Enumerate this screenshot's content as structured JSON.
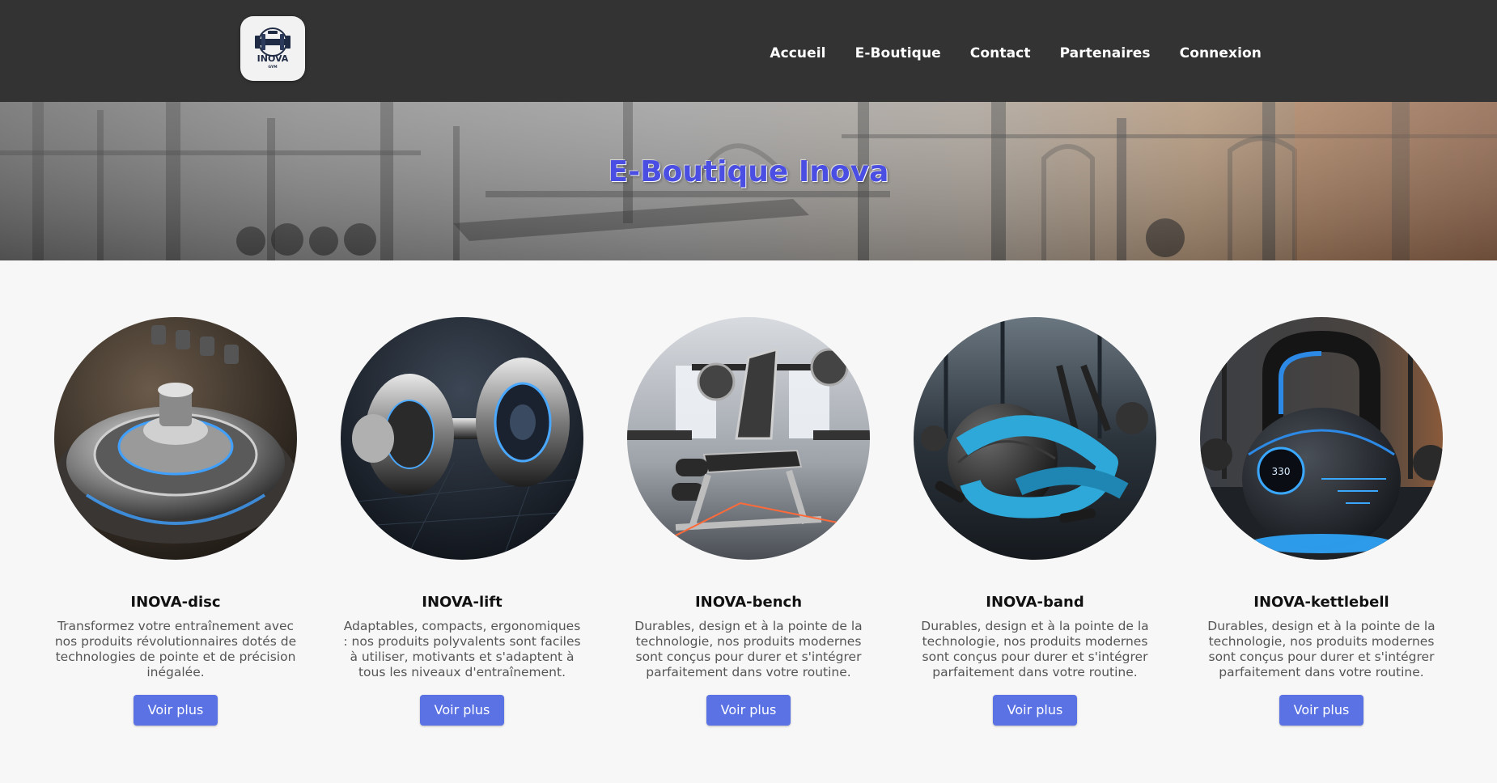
{
  "header": {
    "logo": {
      "text": "INOVA",
      "subtext": "GYM"
    },
    "nav": [
      {
        "label": "Accueil"
      },
      {
        "label": "E-Boutique"
      },
      {
        "label": "Contact"
      },
      {
        "label": "Partenaires"
      },
      {
        "label": "Connexion"
      }
    ]
  },
  "hero": {
    "title": "E-Boutique Inova"
  },
  "products": [
    {
      "name": "INOVA-disc",
      "description": "Transformez votre entraînement avec nos produits révolutionnaires dotés de technologies de pointe et de précision inégalée.",
      "button": "Voir plus",
      "image_icon": "disc-image"
    },
    {
      "name": "INOVA-lift",
      "description": "Adaptables, compacts, ergonomiques : nos produits polyvalents sont faciles à utiliser, motivants et s'adaptent à tous les niveaux d'entraînement.",
      "button": "Voir plus",
      "image_icon": "dumbbell-image"
    },
    {
      "name": "INOVA-bench",
      "description": "Durables, design et à la pointe de la technologie, nos produits modernes sont conçus pour durer et s'intégrer parfaitement dans votre routine.",
      "button": "Voir plus",
      "image_icon": "bench-image"
    },
    {
      "name": "INOVA-band",
      "description": "Durables, design et à la pointe de la technologie, nos produits modernes sont conçus pour durer et s'intégrer parfaitement dans votre routine.",
      "button": "Voir plus",
      "image_icon": "band-image"
    },
    {
      "name": "INOVA-kettlebell",
      "description": "Durables, design et à la pointe de la technologie, nos produits modernes sont conçus pour durer et s'intégrer parfaitement dans votre routine.",
      "button": "Voir plus",
      "image_icon": "kettlebell-image",
      "display_value": "330"
    }
  ],
  "colors": {
    "header_bg": "#333333",
    "hero_title": "#4b4ee3",
    "button_bg": "#5a72e4",
    "page_bg": "#f7f7f7"
  }
}
